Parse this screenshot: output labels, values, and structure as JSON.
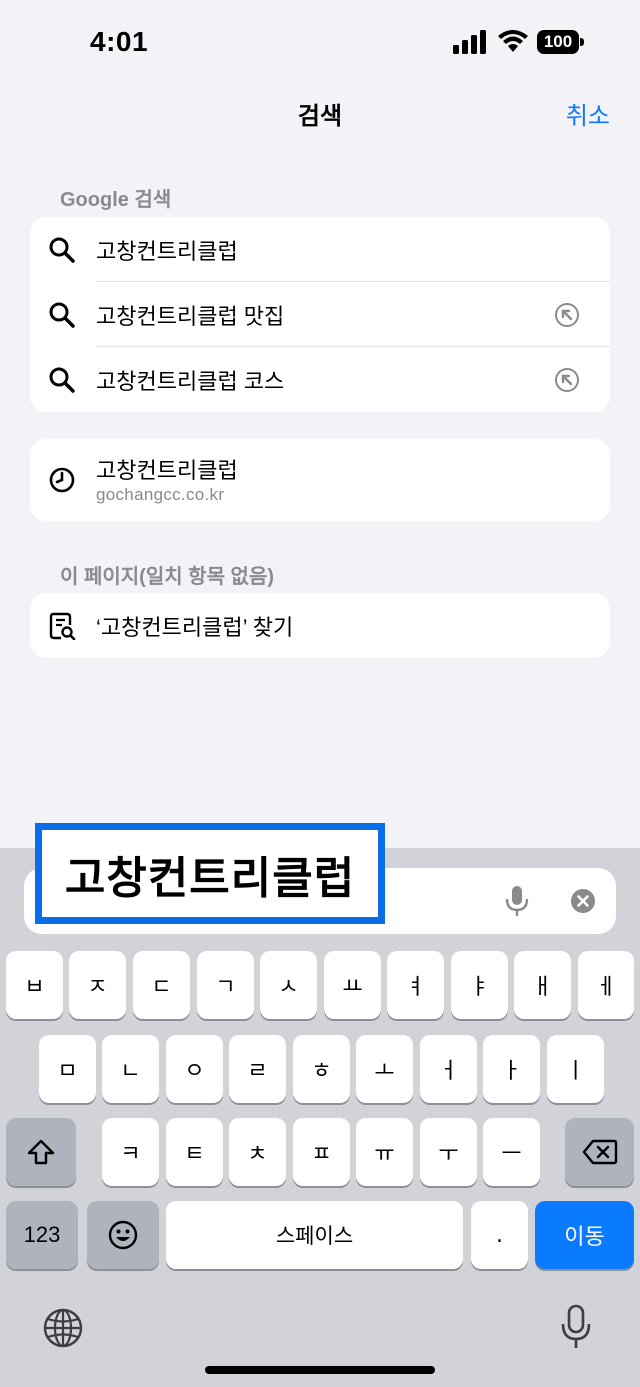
{
  "status_bar": {
    "time": "4:01",
    "battery": "100"
  },
  "nav": {
    "title": "검색",
    "cancel_label": "취소"
  },
  "google_section": {
    "header": "Google 검색",
    "suggestions": [
      {
        "text": "고창컨트리클럽",
        "icon": "search-icon"
      },
      {
        "text": "고창컨트리클럽 맛집",
        "icon": "search-icon",
        "trailing": "fill-in-arrow-icon"
      },
      {
        "text": "고창컨트리클럽 코스",
        "icon": "search-icon",
        "trailing": "fill-in-arrow-icon"
      }
    ]
  },
  "history": {
    "title": "고창컨트리클럽",
    "url": "gochangcc.co.kr",
    "icon": "clock-icon"
  },
  "on_page_section": {
    "header": "이 페이지(일치 항목 없음)",
    "find_label": "‘고창컨트리클럽’ 찾기",
    "icon": "find-on-page-icon"
  },
  "search_field": {
    "value": "고창컨트리클럽"
  },
  "keyboard": {
    "row1": [
      "ㅂ",
      "ㅈ",
      "ㄷ",
      "ㄱ",
      "ㅅ",
      "ㅛ",
      "ㅕ",
      "ㅑ",
      "ㅐ",
      "ㅔ"
    ],
    "row2": [
      "ㅁ",
      "ㄴ",
      "ㅇ",
      "ㄹ",
      "ㅎ",
      "ㅗ",
      "ㅓ",
      "ㅏ",
      "ㅣ"
    ],
    "row3": [
      "ㅋ",
      "ㅌ",
      "ㅊ",
      "ㅍ",
      "ㅠ",
      "ㅜ",
      "ㅡ"
    ],
    "numbers_label": "123",
    "space_label": "스페이스",
    "period_label": ".",
    "go_label": "이동"
  },
  "colors": {
    "accent": "#0a7aff",
    "highlight_border": "#0a6ee8",
    "background": "#f2f2f7"
  }
}
